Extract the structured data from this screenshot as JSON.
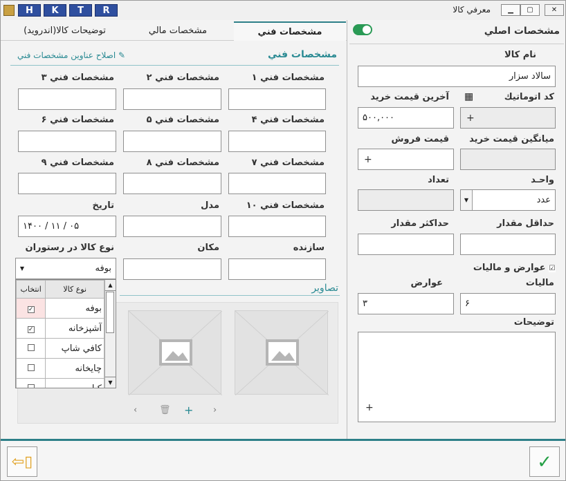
{
  "window": {
    "title": "معرفي كالا",
    "hotkeys": [
      "H",
      "K",
      "T",
      "R"
    ]
  },
  "tabs": [
    "مشخصات فني",
    "مشخصات مالي",
    "توضيحات كالا(اندرويد)"
  ],
  "main": {
    "title": "مشخصات اصلي",
    "name_label": "نام كالا",
    "name_value": "سالاد سزار",
    "autocode_label": "كد اتوماتيك",
    "last_price_label": "آخرين قيمت خريد",
    "last_price_value": "۵۰۰,۰۰۰",
    "avg_price_label": "ميانگين قيمت خريد",
    "sell_price_label": "قيمت فروش",
    "unit_label": "واحـد",
    "unit_value": "عدد",
    "count_label": "تعداد",
    "min_label": "حداقل مقدار",
    "max_label": "حداكثر مقدار",
    "tax_check_label": "عوارض و ماليات",
    "tax_label": "ماليات",
    "tax_value": "۶",
    "toll_label": "عوارض",
    "toll_value": "۳",
    "desc_label": "توضيحات",
    "plus": "+"
  },
  "tech": {
    "section_title": "مشخصات فني",
    "edit_link": "اصلاح عناوين مشخصات فني",
    "fields": [
      "مشخصات فني ۱",
      "مشخصات فني ۲",
      "مشخصات فني ۳",
      "مشخصات فني ۴",
      "مشخصات فني ۵",
      "مشخصات فني ۶",
      "مشخصات فني ۷",
      "مشخصات فني ۸",
      "مشخصات فني ۹",
      "مشخصات فني ۱۰",
      "مدل",
      "تاريخ"
    ],
    "date_value": "۱۴۰۰  /  ۱۱  /  ۰۵",
    "maker_label": "سازنده",
    "place_label": "مكان",
    "type_label": "نوع كالا در رستوران",
    "type_value": "بوفه",
    "images_label": "تصاوير"
  },
  "dropdown": {
    "headers": [
      "انتخاب",
      "نوع كالا"
    ],
    "rows": [
      {
        "name": "بوفه",
        "checked": true
      },
      {
        "name": "آشپزخانه",
        "checked": true
      },
      {
        "name": "كافي شاپ",
        "checked": false
      },
      {
        "name": "چايخانه",
        "checked": false
      },
      {
        "name": "كبا..",
        "checked": false
      }
    ]
  }
}
